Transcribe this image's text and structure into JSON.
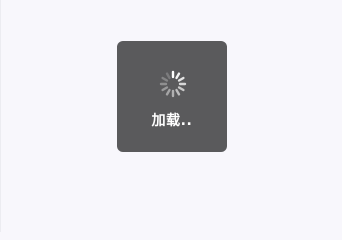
{
  "toast": {
    "label": "加载.."
  },
  "spinner": {
    "icon": "loading-spinner-icon",
    "color": "#ffffff"
  },
  "colors": {
    "background": "#f8f7fc",
    "toast_background": "#5a5a5c",
    "text": "#ffffff"
  }
}
